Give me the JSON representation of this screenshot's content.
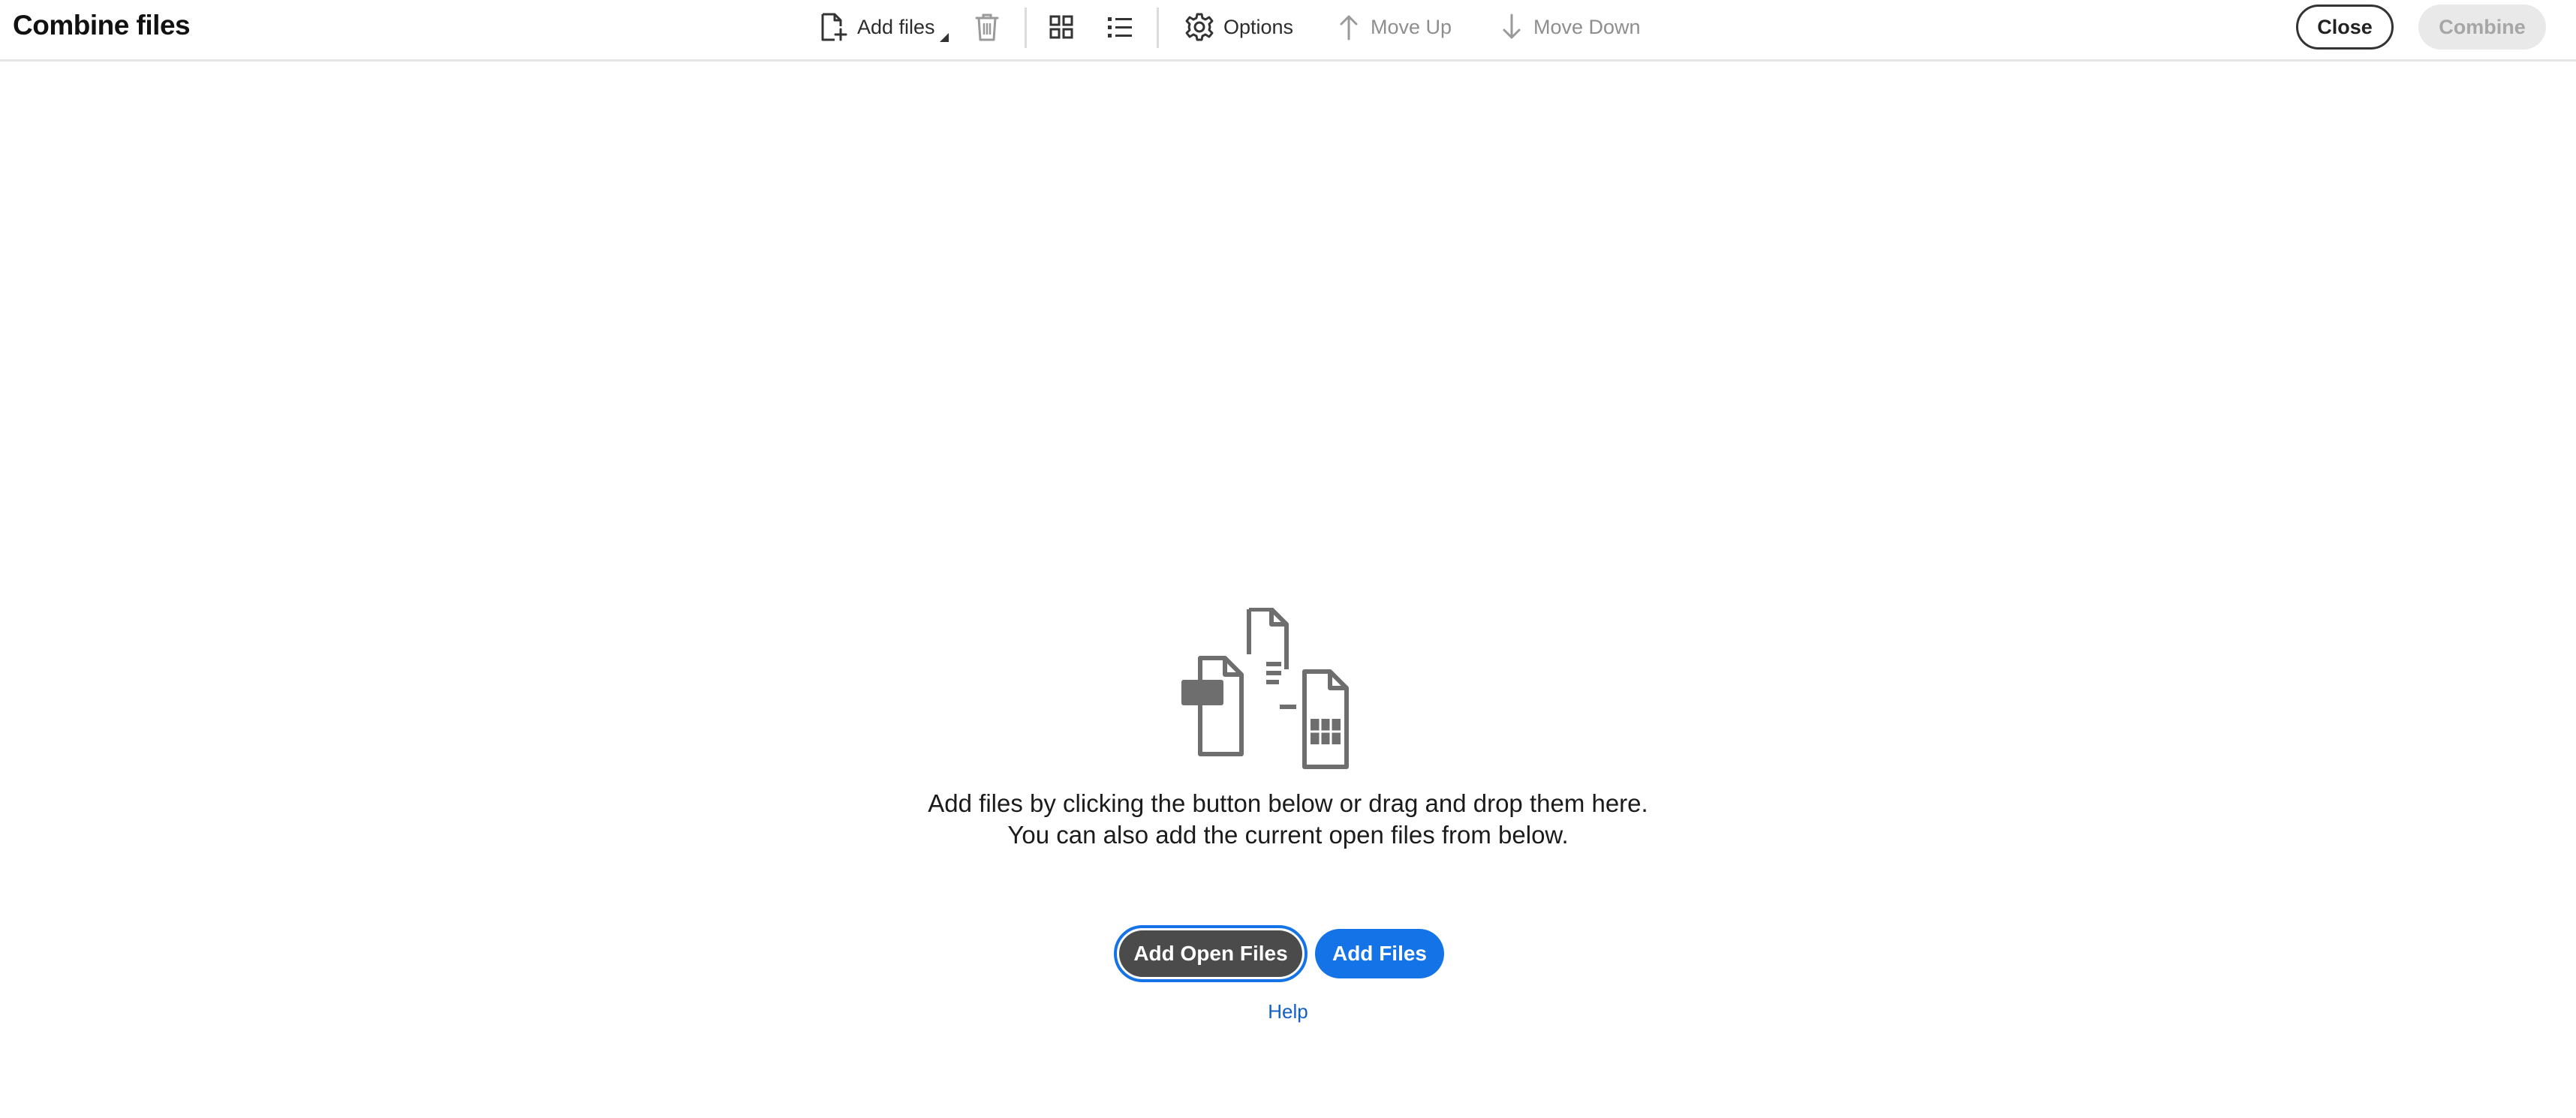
{
  "app": {
    "title": "Combine files"
  },
  "toolbar": {
    "add_files_label": "Add files",
    "options_label": "Options",
    "move_up_label": "Move Up",
    "move_down_label": "Move Down",
    "close_label": "Close",
    "combine_label": "Combine",
    "icons": [
      "add-file-icon",
      "dropdown-caret-icon",
      "trash-icon",
      "grid-view-icon",
      "list-view-icon",
      "gear-icon",
      "arrow-up-icon",
      "arrow-down-icon"
    ]
  },
  "empty_state": {
    "line1": "Add files by clicking the button below or drag and drop them here.",
    "line2": "You can also add the current open files from below.",
    "add_open_files_label": "Add Open Files",
    "add_files_label": "Add Files",
    "help_label": "Help",
    "illustration_icon": "combine-documents-illustration"
  },
  "colors": {
    "accent": "#1473e6",
    "dark_button": "#4b4b4b",
    "disabled_bg": "#e9e9e9",
    "link": "#1160c6"
  }
}
